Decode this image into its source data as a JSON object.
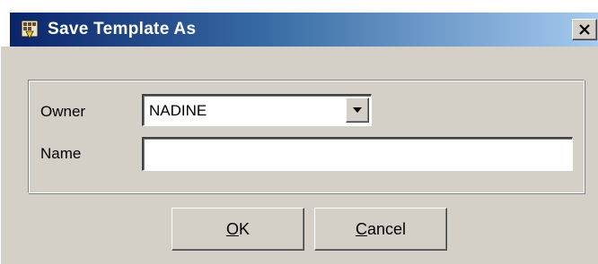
{
  "window": {
    "title": "Save Template As",
    "icon": "app-icon",
    "close_icon": "close-icon"
  },
  "form": {
    "owner_label": "Owner",
    "owner_value": "NADINE",
    "name_label": "Name",
    "name_value": ""
  },
  "buttons": {
    "ok": {
      "mnemonic": "O",
      "rest": "K"
    },
    "cancel": {
      "mnemonic": "C",
      "rest": "ancel"
    }
  },
  "colors": {
    "title_start": "#0a246a",
    "title_end": "#a6caf0",
    "face": "#d4d0c8"
  }
}
